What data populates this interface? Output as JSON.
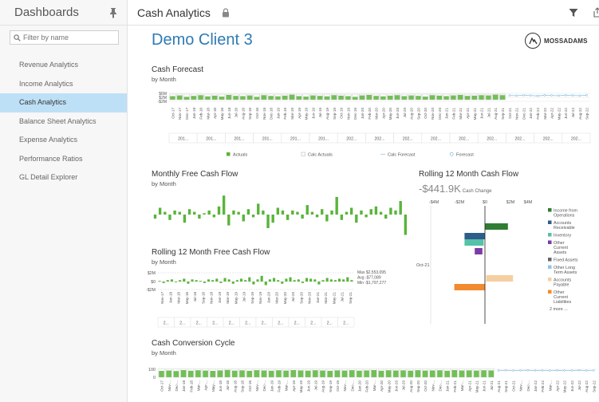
{
  "sidebar": {
    "title": "Dashboards",
    "filter_placeholder": "Filter by name",
    "items": [
      {
        "label": "Revenue Analytics",
        "active": false
      },
      {
        "label": "Income Analytics",
        "active": false
      },
      {
        "label": "Cash Analytics",
        "active": true
      },
      {
        "label": "Balance Sheet Analytics",
        "active": false
      },
      {
        "label": "Expense Analytics",
        "active": false
      },
      {
        "label": "Performance Ratios",
        "active": false
      },
      {
        "label": "GL Detail Explorer",
        "active": false
      }
    ]
  },
  "header": {
    "title": "Cash Analytics"
  },
  "main": {
    "client": "Demo Client 3",
    "logo": "MOSSADAMS",
    "cash_forecast": {
      "title": "Cash Forecast",
      "subtitle": "by Month"
    },
    "free_cash_flow": {
      "title": "Monthly Free Cash Flow",
      "subtitle": "by Month"
    },
    "rolling_fcf": {
      "title": "Rolling 12 Month Free Cash Flow",
      "subtitle": "by Month"
    },
    "rolling_cf": {
      "title": "Rolling 12 Month Cash Flow",
      "kpi_value": "-$441.9K",
      "kpi_label": "Cash Change"
    },
    "ccc": {
      "title": "Cash Conversion Cycle",
      "subtitle": "by Month"
    }
  },
  "colors": {
    "accent": "#2e7bb5",
    "green": "#59b43a",
    "active_nav": "#bde0f6"
  },
  "chart_data": [
    {
      "type": "bar",
      "title": "Cash Forecast",
      "subtitle": "by Month",
      "y_ticks": [
        "$6M",
        "$2M",
        "-$2M"
      ],
      "categories": [
        "Oct-17",
        "Nov-17",
        "Dec-17",
        "Jan-18",
        "Feb-18",
        "Mar-18",
        "Apr-18",
        "May-18",
        "Jun-18",
        "Jul-18",
        "Aug-18",
        "Sep-18",
        "Oct-18",
        "Nov-18",
        "Dec-18",
        "Jan-19",
        "Feb-19",
        "Mar-19",
        "Apr-19",
        "May-19",
        "Jun-19",
        "Jul-19",
        "Aug-19",
        "Sep-19",
        "Oct-19",
        "Nov-19",
        "Dec-19",
        "Jan-20",
        "Feb-20",
        "Mar-20",
        "Apr-20",
        "May-20",
        "Jun-20",
        "Jul-20",
        "Aug-20",
        "Sep-20",
        "Oct-20",
        "Nov-20",
        "Dec-20",
        "Jan-21",
        "Feb-21",
        "Mar-21",
        "Apr-21",
        "May-21",
        "Jun-21",
        "Jul-21",
        "Aug-21",
        "Sep-21",
        "Oct-21",
        "Nov-21",
        "Dec-21",
        "Jan-22",
        "Feb-22",
        "Mar-22",
        "Apr-22",
        "May-22",
        "Jun-22",
        "Jul-22",
        "Aug-22",
        "Sep-22"
      ],
      "year_labels": [
        "201...",
        "201...",
        "201...",
        "201...",
        "201...",
        "201...",
        "202...",
        "202...",
        "202...",
        "202...",
        "202...",
        "202...",
        "202...",
        "202...",
        "202..."
      ],
      "series": [
        {
          "name": "Actuals",
          "values": [
            1.5,
            1.8,
            1.2,
            1.6,
            1.9,
            1.4,
            1.7,
            1.3,
            2.0,
            1.6,
            1.5,
            1.8,
            1.2,
            1.9,
            1.6,
            1.4,
            1.7,
            2.1,
            1.5,
            1.3,
            1.8,
            1.6,
            1.4,
            1.9,
            1.7,
            1.5,
            1.2,
            1.8,
            2.0,
            1.6,
            1.4,
            1.7,
            1.9,
            1.5,
            1.8,
            1.6,
            1.3,
            1.9,
            1.7,
            1.5,
            1.8,
            2.0,
            1.6,
            1.7,
            1.9,
            1.8,
            2.1,
            1.9
          ]
        },
        {
          "name": "Forecast",
          "values": [
            1.8,
            1.7,
            1.9,
            1.8,
            1.6,
            1.9,
            1.8,
            1.7,
            1.9,
            1.8,
            1.7,
            1.9
          ]
        }
      ],
      "legend": [
        "Actuals",
        "Calc Actuals",
        "Calc Forecast",
        "Forecast"
      ],
      "legend_position": "bottom",
      "grid": true
    },
    {
      "type": "bar",
      "title": "Monthly Free Cash Flow",
      "subtitle": "by Month",
      "values": [
        -0.3,
        0.5,
        0.2,
        -0.4,
        0.3,
        0.2,
        -0.6,
        0.4,
        0.2,
        -0.3,
        0.1,
        0.3,
        -0.2,
        0.6,
        1.4,
        -0.8,
        0.3,
        0.2,
        -0.5,
        0.4,
        -0.2,
        0.8,
        0.3,
        -1.0,
        -0.6,
        0.5,
        0.3,
        -0.4,
        0.3,
        0.2,
        -0.3,
        0.7,
        0.2,
        -0.2,
        0.4,
        -0.5,
        0.3,
        1.3,
        -0.4,
        0.2,
        0.5,
        -0.6,
        0.3,
        -0.2,
        0.4,
        0.6,
        0.2,
        -0.3,
        0.5,
        0.3,
        1.0,
        -1.5
      ]
    },
    {
      "type": "bar",
      "title": "Rolling 12 Month Free Cash Flow",
      "subtitle": "by Month",
      "y_ticks": [
        "$2M",
        "$0",
        "-$2M"
      ],
      "categories": [
        "Nov-17",
        "Jan-18",
        "Mar-18",
        "May-18",
        "Jul-18",
        "Sep-18",
        "Nov-18",
        "Jan-19",
        "Mar-19",
        "May-19",
        "Jul-19",
        "Sep-19",
        "Nov-19",
        "Jan-20",
        "Mar-20",
        "May-20",
        "Jul-20",
        "Sep-20",
        "Nov-20",
        "Jan-21",
        "Mar-21",
        "May-21",
        "Jul-21",
        "Sep-21"
      ],
      "year_labels": [
        "2...",
        "2...",
        "2...",
        "2...",
        "2...",
        "2...",
        "2...",
        "2...",
        "2...",
        "2...",
        "2...",
        "2..."
      ],
      "values": [
        0.1,
        -0.2,
        0.2,
        0.3,
        -0.1,
        0.2,
        0.4,
        -0.3,
        0.3,
        0.2,
        0.1,
        -0.2,
        0.3,
        0.2,
        0.4,
        -0.2,
        0.5,
        0.3,
        -0.3,
        0.2,
        0.4,
        0.2,
        0.6,
        -0.4,
        0.3,
        0.8,
        -0.5,
        0.3,
        0.5,
        0.2,
        -0.3,
        0.4,
        0.6,
        0.2,
        0.3,
        -0.2,
        0.5,
        0.4,
        0.3,
        -0.4,
        0.2,
        0.5,
        0.3,
        0.2,
        0.4,
        0.3,
        0.6,
        0.2
      ],
      "annotations": [
        "Max $2,553,095",
        "Avg -$77,089",
        "Min -$1,797,277"
      ]
    },
    {
      "type": "bar",
      "title": "Rolling 12 Month Cash Flow",
      "orientation": "horizontal-waterfall",
      "x_ticks": [
        "-$4M",
        "-$2M",
        "$0",
        "$2M",
        "$4M"
      ],
      "category": "Oct-21",
      "series": [
        {
          "name": "Income from Operations",
          "color": "#2e7d32",
          "start": 0,
          "end": 1.8
        },
        {
          "name": "Accounts Receivable",
          "color": "#2f5d8a",
          "start": 0,
          "end": -1.6
        },
        {
          "name": "Inventory",
          "color": "#55c1a8",
          "start": -0.1,
          "end": -1.6
        },
        {
          "name": "Other Current Assets",
          "color": "#7b3aa6",
          "start": -0.2,
          "end": -0.8
        },
        {
          "name": "Fixed Assets",
          "color": "#666666",
          "start": 0,
          "end": 0
        },
        {
          "name": "Other Long Term Assets",
          "color": "#8ec6e9",
          "start": 0,
          "end": 0
        },
        {
          "name": "Accounts Payable",
          "color": "#f5cfa0",
          "start": 0.1,
          "end": 2.2
        },
        {
          "name": "Other Current Liabilities",
          "color": "#f28a2e",
          "start": 0,
          "end": -2.4
        }
      ],
      "legend_more": "2 more ..."
    },
    {
      "type": "bar",
      "title": "Cash Conversion Cycle",
      "subtitle": "by Month",
      "y_ticks": [
        "100",
        "0"
      ],
      "categories": [
        "Oct-17",
        "Nov-...",
        "Dec-...",
        "Jan-18",
        "Feb-18",
        "Mar-...",
        "Apr-...",
        "May-...",
        "Jun-18",
        "Jul-18",
        "Aug-18",
        "Sep-18",
        "Oct-18",
        "Nov-...",
        "Dec-...",
        "Jan-19",
        "Feb-19",
        "Mar-...",
        "Apr-19",
        "May-19",
        "Jun-19",
        "Jul-19",
        "Aug-19",
        "Sep-19",
        "Oct-19",
        "Nov-...",
        "Dec-...",
        "Jan-20",
        "Feb-20",
        "Mar-...",
        "Apr-20",
        "May-20",
        "Jun-20",
        "Jul-20",
        "Aug-20",
        "Sep-20",
        "Oct-20",
        "Nov-...",
        "Dec-...",
        "Jan-21",
        "Feb-21",
        "Mar-...",
        "Apr-21",
        "May-21",
        "Jun-21",
        "Jul-21",
        "Aug-21",
        "Sep-21",
        "Oct-21",
        "Nov-...",
        "Dec-...",
        "Jan-22",
        "Feb-22",
        "Mar-...",
        "Apr-22",
        "May-22",
        "Jun-22",
        "Jul-22",
        "Aug-22",
        "Sep-22"
      ],
      "values": [
        80,
        85,
        78,
        90,
        82,
        88,
        84,
        80,
        86,
        92,
        83,
        87,
        81,
        89,
        85,
        82,
        88,
        84,
        90,
        86,
        83,
        88,
        85,
        81,
        87,
        84,
        89,
        83,
        86,
        90,
        82,
        88,
        85,
        87,
        83,
        89,
        84,
        86,
        88,
        82,
        90,
        85,
        87,
        84,
        88,
        86
      ],
      "forecast": [
        85,
        87,
        84,
        86,
        88,
        85,
        86,
        84,
        87,
        85,
        86,
        88,
        85,
        86
      ]
    }
  ]
}
